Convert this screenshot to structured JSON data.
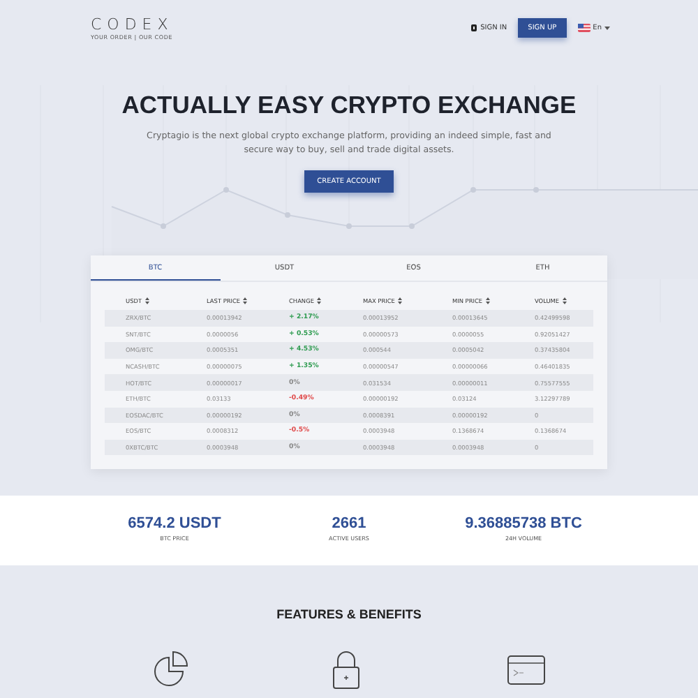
{
  "header": {
    "logo": "CODEX",
    "tagline": "YOUR ORDER | OUR CODE",
    "sign_in": "SIGN IN",
    "sign_up": "SIGN UP",
    "language": "En"
  },
  "hero": {
    "title": "ACTUALLY EASY CRYPTO EXCHANGE",
    "text": "Cryptagio is the next global crypto exchange platform, providing an indeed simple, fast and secure way to buy, sell and trade digital assets.",
    "button": "CREATE ACCOUNT"
  },
  "market": {
    "tabs": [
      {
        "label": "BTC",
        "selected": true
      },
      {
        "label": "USDT",
        "selected": false
      },
      {
        "label": "EOS",
        "selected": false
      },
      {
        "label": "ETH",
        "selected": false
      }
    ],
    "columns": [
      "USDT",
      "LAST PRICE",
      "CHANGE",
      "MAX PRICE",
      "MIN PRICE",
      "VOLUME"
    ],
    "rows": [
      {
        "pair": "ZRX/BTC",
        "last": "0.00013942",
        "change": "+ 2.17%",
        "color": "#2e9b50",
        "max": "0.00013952",
        "min": "0.00013645",
        "volume": "0.42499598"
      },
      {
        "pair": "SNT/BTC",
        "last": "0.0000056",
        "change": "+ 0.53%",
        "color": "#2e9b50",
        "max": "0.00000573",
        "min": "0.0000055",
        "volume": "0.92051427"
      },
      {
        "pair": "OMG/BTC",
        "last": "0.0005351",
        "change": "+ 4.53%",
        "color": "#2e9b50",
        "max": "0.000544",
        "min": "0.0005042",
        "volume": "0.37435804"
      },
      {
        "pair": "NCASH/BTC",
        "last": "0.00000075",
        "change": "+ 1.35%",
        "color": "#2e9b50",
        "max": "0.00000547",
        "min": "0.00000066",
        "volume": "0.46401835"
      },
      {
        "pair": "HOT/BTC",
        "last": "0.00000017",
        "change": "0%",
        "color": "#888888",
        "max": "0.031534",
        "min": "0.00000011",
        "volume": "0.75577555"
      },
      {
        "pair": "ETH/BTC",
        "last": "0.03133",
        "change": "-0.49%",
        "color": "#e04a4a",
        "max": "0.00000192",
        "min": "0.03124",
        "volume": "3.12297789"
      },
      {
        "pair": "EOSDAC/BTC",
        "last": "0.00000192",
        "change": "0%",
        "color": "#888888",
        "max": "0.0008391",
        "min": "0.00000192",
        "volume": "0"
      },
      {
        "pair": "EOS/BTC",
        "last": "0.0008312",
        "change": "-0.5%",
        "color": "#e04a4a",
        "max": "0.0003948",
        "min": "0.1368674",
        "volume": "0.1368674"
      },
      {
        "pair": "0XBTC/BTC",
        "last": "0.0003948",
        "change": "0%",
        "color": "#888888",
        "max": "0.0003948",
        "min": "0.0003948",
        "volume": "0"
      }
    ]
  },
  "stats": [
    {
      "value": "6574.2 USDT",
      "label": "BTC PRICE"
    },
    {
      "value": "2661",
      "label": "ACTIVE USERS"
    },
    {
      "value": "9.36885738 BTC",
      "label": "24H VOLUME"
    }
  ],
  "features": {
    "title": "FEATURES & BENEFITS",
    "items": [
      {
        "kind": "chart"
      },
      {
        "kind": "lock"
      },
      {
        "kind": "terminal"
      }
    ]
  }
}
